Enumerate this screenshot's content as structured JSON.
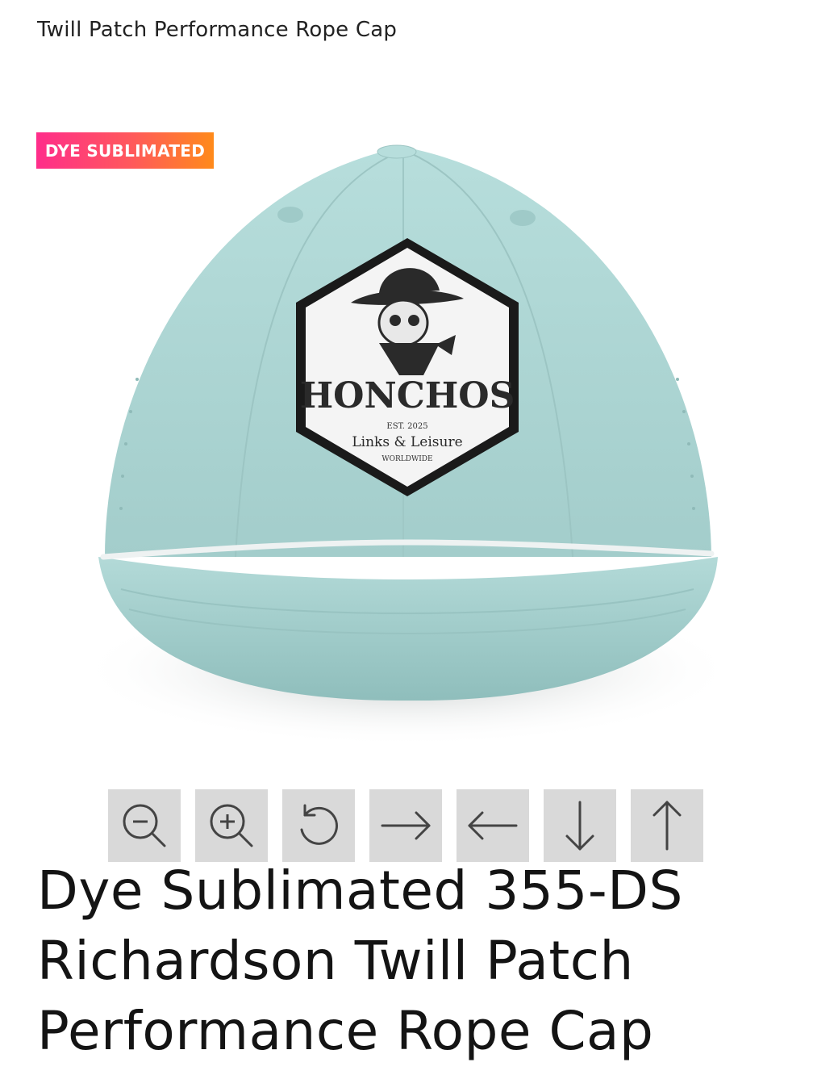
{
  "header": {
    "title": "Twill Patch Performance Rope Cap"
  },
  "badge": {
    "label": "DYE SUBLIMATED"
  },
  "patch": {
    "brand": "HONCHOS",
    "est": "EST. 2025",
    "tagline": "Links & Leisure",
    "sub": "WORLDWIDE"
  },
  "toolbar": {
    "buttons": [
      {
        "name": "zoom-out",
        "icon": "zoom-out-icon"
      },
      {
        "name": "zoom-in",
        "icon": "zoom-in-icon"
      },
      {
        "name": "rotate",
        "icon": "rotate-icon"
      },
      {
        "name": "move-right",
        "icon": "arrow-right-icon"
      },
      {
        "name": "move-left",
        "icon": "arrow-left-icon"
      },
      {
        "name": "move-down",
        "icon": "arrow-down-icon"
      },
      {
        "name": "move-up",
        "icon": "arrow-up-icon"
      }
    ]
  },
  "product": {
    "title": "Dye Sublimated 355-DS Richardson Twill Patch Performance Rope Cap"
  },
  "colors": {
    "cap": "#a9d3d1",
    "badge_start": "#ff2d8a",
    "badge_end": "#ff8a1a",
    "toolbar_bg": "#d9d9d9"
  }
}
